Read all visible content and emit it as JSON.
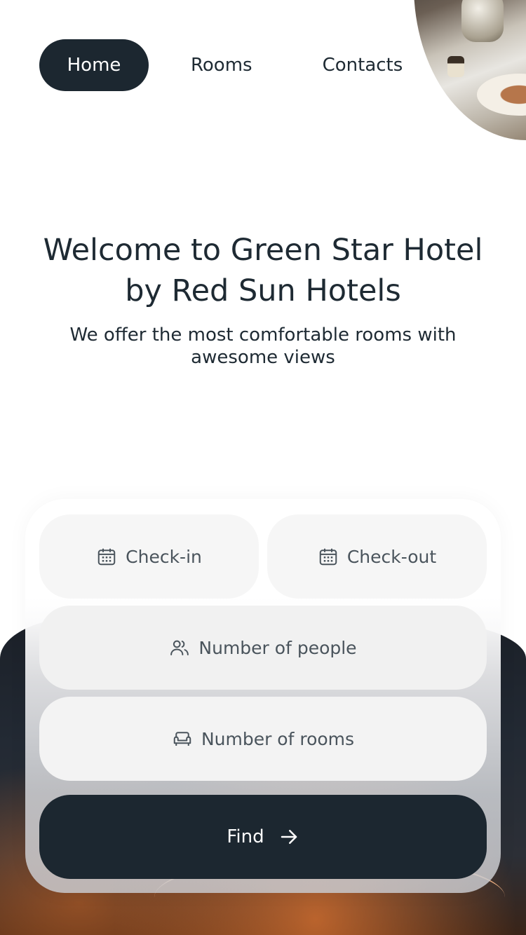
{
  "nav": {
    "items": [
      {
        "label": "Home",
        "active": true
      },
      {
        "label": "Rooms",
        "active": false
      },
      {
        "label": "Contacts",
        "active": false
      }
    ]
  },
  "hero": {
    "title_line1": "Welcome to Green Star Hotel",
    "title_line2": "by Red Sun Hotels",
    "subtitle": "We offer the most comfortable rooms with awesome views"
  },
  "booking": {
    "check_in": {
      "label": "Check-in",
      "icon": "calendar-icon"
    },
    "check_out": {
      "label": "Check-out",
      "icon": "calendar-icon"
    },
    "people": {
      "label": "Number of people",
      "icon": "users-icon"
    },
    "rooms": {
      "label": "Number of rooms",
      "icon": "sofa-icon"
    },
    "find": {
      "label": "Find",
      "icon": "arrow-right-icon"
    }
  },
  "colors": {
    "primary": "#1c2730",
    "text": "#1e2a33",
    "field_bg": "#f6f6f6",
    "field_text": "#4a545c"
  }
}
